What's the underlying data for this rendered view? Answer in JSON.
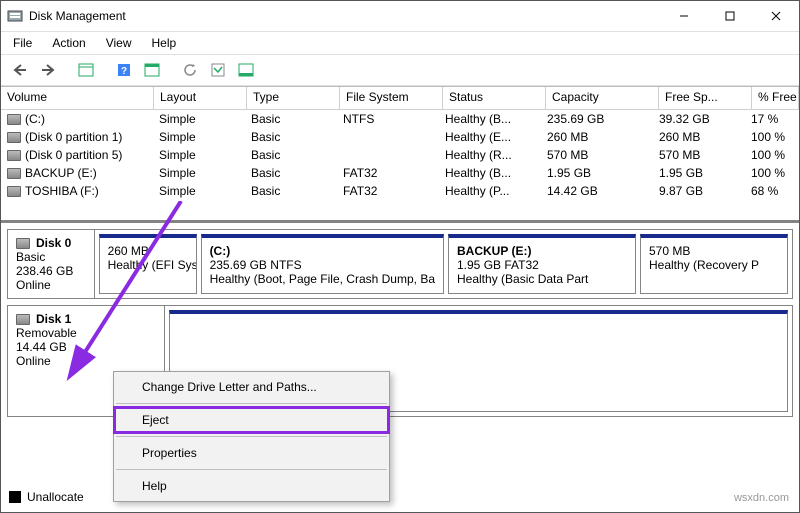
{
  "window": {
    "title": "Disk Management"
  },
  "menubar": [
    "File",
    "Action",
    "View",
    "Help"
  ],
  "columns": {
    "volume": "Volume",
    "layout": "Layout",
    "type": "Type",
    "fs": "File System",
    "status": "Status",
    "capacity": "Capacity",
    "free": "Free Sp...",
    "pct": "% Free"
  },
  "rows": [
    {
      "volume": "(C:)",
      "layout": "Simple",
      "type": "Basic",
      "fs": "NTFS",
      "status": "Healthy (B...",
      "capacity": "235.69 GB",
      "free": "39.32 GB",
      "pct": "17 %"
    },
    {
      "volume": "(Disk 0 partition 1)",
      "layout": "Simple",
      "type": "Basic",
      "fs": "",
      "status": "Healthy (E...",
      "capacity": "260 MB",
      "free": "260 MB",
      "pct": "100 %"
    },
    {
      "volume": "(Disk 0 partition 5)",
      "layout": "Simple",
      "type": "Basic",
      "fs": "",
      "status": "Healthy (R...",
      "capacity": "570 MB",
      "free": "570 MB",
      "pct": "100 %"
    },
    {
      "volume": "BACKUP (E:)",
      "layout": "Simple",
      "type": "Basic",
      "fs": "FAT32",
      "status": "Healthy (B...",
      "capacity": "1.95 GB",
      "free": "1.95 GB",
      "pct": "100 %"
    },
    {
      "volume": "TOSHIBA (F:)",
      "layout": "Simple",
      "type": "Basic",
      "fs": "FAT32",
      "status": "Healthy (P...",
      "capacity": "14.42 GB",
      "free": "9.87 GB",
      "pct": "68 %"
    }
  ],
  "disk0": {
    "name": "Disk 0",
    "type": "Basic",
    "size": "238.46 GB",
    "status": "Online",
    "parts": {
      "efi": {
        "line1": "260 MB",
        "line2": "Healthy (EFI Syst"
      },
      "c": {
        "title": "(C:)",
        "line1": "235.69 GB NTFS",
        "line2": "Healthy (Boot, Page File, Crash Dump, Ba"
      },
      "bak": {
        "title": "BACKUP  (E:)",
        "line1": "1.95 GB FAT32",
        "line2": "Healthy (Basic Data Part"
      },
      "rec": {
        "line1": "570 MB",
        "line2": "Healthy (Recovery P"
      }
    }
  },
  "disk1": {
    "name": "Disk 1",
    "type": "Removable",
    "size": "14.44 GB",
    "status": "Online"
  },
  "context_menu": {
    "item0": "Change Drive Letter and Paths...",
    "item1": "Eject",
    "item2": "Properties",
    "item3": "Help"
  },
  "legend": {
    "unalloc": "Unallocate"
  },
  "watermark": "wsxdn.com"
}
